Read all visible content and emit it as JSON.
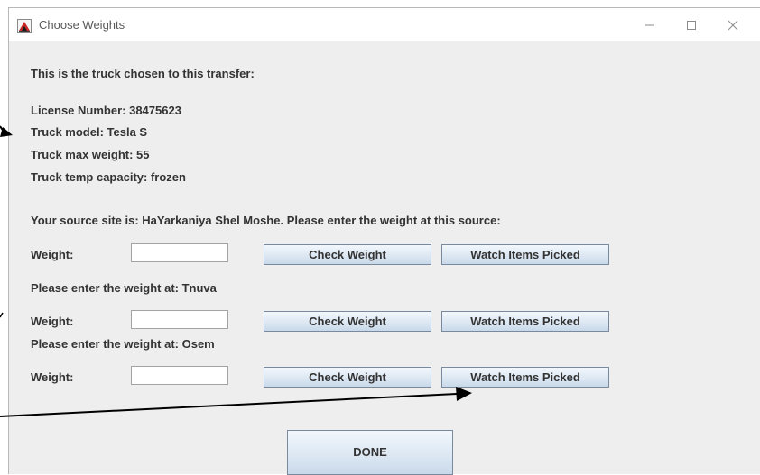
{
  "window": {
    "title": "Choose Weights",
    "icon": "java-app-icon",
    "controls": [
      "minimize-icon",
      "maximize-icon",
      "close-icon"
    ]
  },
  "content": {
    "heading": "This is the truck chosen to this transfer:",
    "license_number": "License Number: 38475623",
    "truck_model": "Truck model: Tesla S",
    "truck_max_weight": "Truck max weight: 55",
    "truck_temp_capacity": "Truck temp capacity: frozen",
    "source_prompt": "Your source site is: HaYarkaniya Shel Moshe. Please enter the weight at this source:",
    "weight_label": "Weight:",
    "sites": [
      {
        "prompt": "",
        "weight_value": "",
        "check_label": "Check Weight",
        "watch_label": "Watch Items Picked"
      },
      {
        "prompt": "Please enter the weight at: Tnuva",
        "weight_value": "",
        "check_label": "Check Weight",
        "watch_label": "Watch Items Picked"
      },
      {
        "prompt": "Please enter the weight at: Osem",
        "weight_value": "",
        "check_label": "Check Weight",
        "watch_label": "Watch Items Picked"
      }
    ],
    "done_label": "DONE"
  },
  "colors": {
    "window_bg": "#eeeeee",
    "text": "#333333",
    "button_top": "#f2f7fc",
    "button_bottom": "#c9d9ea",
    "button_border": "#7a8a9e"
  }
}
